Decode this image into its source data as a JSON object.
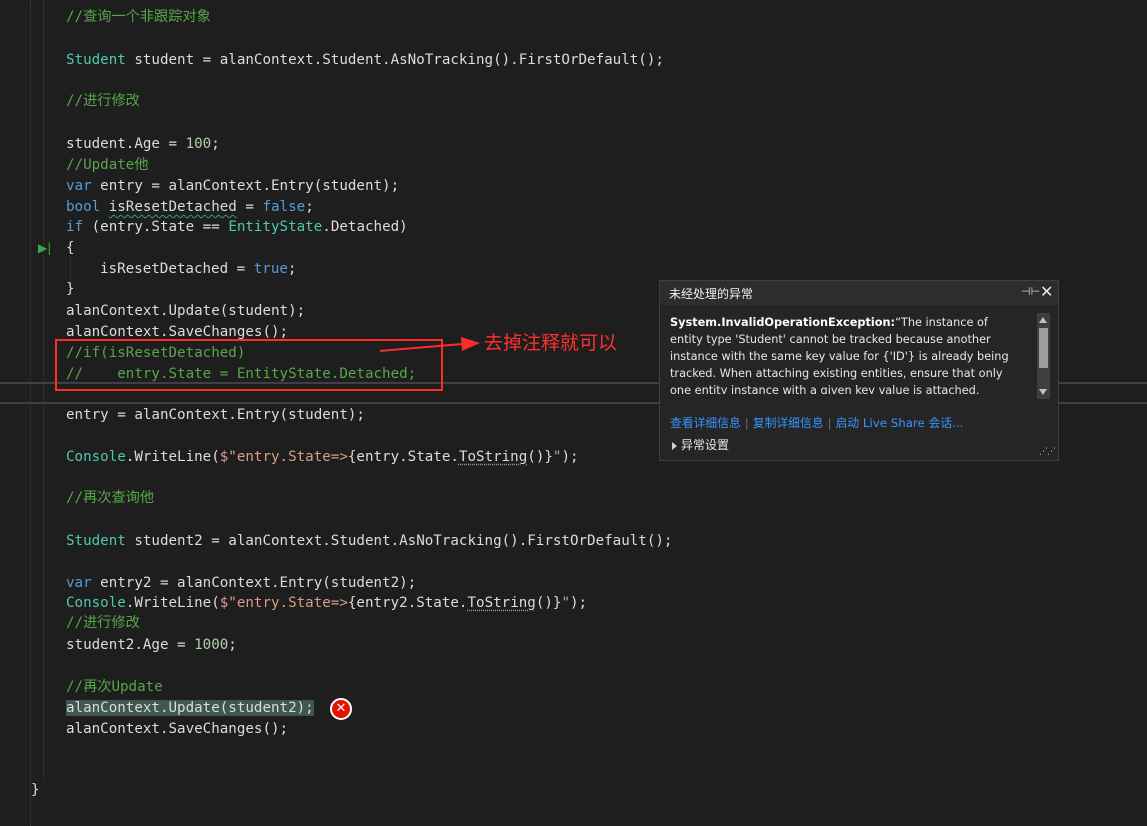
{
  "code_lines": {
    "l1": "//查询一个非跟踪对象",
    "l2_type": "Student",
    "l2_rest": " student = alanContext.Student.AsNoTracking().FirstOrDefault();",
    "l3": "//进行修改",
    "l4_a": "student.Age = ",
    "l4_num": "100",
    "l4_b": ";",
    "l5": "//Update他",
    "l6_kw": "var",
    "l6_rest": " entry = alanContext.Entry(student);",
    "l7_kw": "bool",
    "l7_sp": " ",
    "l7_var": "isResetDetached",
    "l7_eq": " = ",
    "l7_val": "false",
    "l7_end": ";",
    "l8_kw": "if",
    "l8_a": " (entry.State == ",
    "l8_ty": "EntityState",
    "l8_b": ".Detached)",
    "l9": "{",
    "l10_var": "isResetDetached",
    "l10_eq": " = ",
    "l10_val": "true",
    "l10_end": ";",
    "l11": "}",
    "l12": "alanContext.Update(student);",
    "l13": "alanContext.SaveChanges();",
    "l14": "//if(isResetDetached)",
    "l15": "//    entry.State = EntityState.Detached;",
    "l16": "entry = alanContext.Entry(student);",
    "l17_ty": "Console",
    "l17_a": ".WriteLine(",
    "l17_s1": "$\"entry.State=>",
    "l17_b": "{entry.State.",
    "l17_c": "ToString",
    "l17_d": "()}",
    "l17_s2": "\"",
    "l17_e": ");",
    "l18": "//再次查询他",
    "l19_type": "Student",
    "l19_rest": " student2 = alanContext.Student.AsNoTracking().FirstOrDefault();",
    "l20_kw": "var",
    "l20_rest": " entry2 = alanContext.Entry(student2);",
    "l21_ty": "Console",
    "l21_a": ".WriteLine(",
    "l21_s1": "$\"entry.State=>",
    "l21_b": "{entry2.State.",
    "l21_c": "ToString",
    "l21_d": "()}",
    "l21_s2": "\"",
    "l21_e": ");",
    "l22": "//进行修改",
    "l23_a": "student2.Age = ",
    "l23_num": "1000",
    "l23_b": ";",
    "l24": "//再次Update",
    "l25": "alanContext.Update(student2);",
    "l26": "alanContext.SaveChanges();",
    "l27": "}"
  },
  "annotation": {
    "text": "去掉注释就可以"
  },
  "exception_popup": {
    "title": "未经处理的异常",
    "exception_type": "System.InvalidOperationException:",
    "message": "“The instance of entity type 'Student' cannot be tracked because another instance with the same key value for {'ID'} is already being tracked. When attaching existing entities, ensure that only one entity instance with a given key value is attached. Consider using",
    "links": [
      "查看详细信息",
      "复制详细信息",
      "启动 Live Share 会话..."
    ],
    "settings_label": "异常设置"
  },
  "icons": {
    "pin": "pin-icon",
    "close": "close-icon",
    "error": "error-icon",
    "current_statement": "current-statement-icon"
  },
  "colors": {
    "editor_bg": "#1e1e1e",
    "comment": "#57a64a",
    "keyword": "#569cd6",
    "type": "#4ec9b0",
    "string": "#d69d85",
    "number": "#b5cea8",
    "annotation_red": "#ff2b2b",
    "link": "#3794ff"
  }
}
